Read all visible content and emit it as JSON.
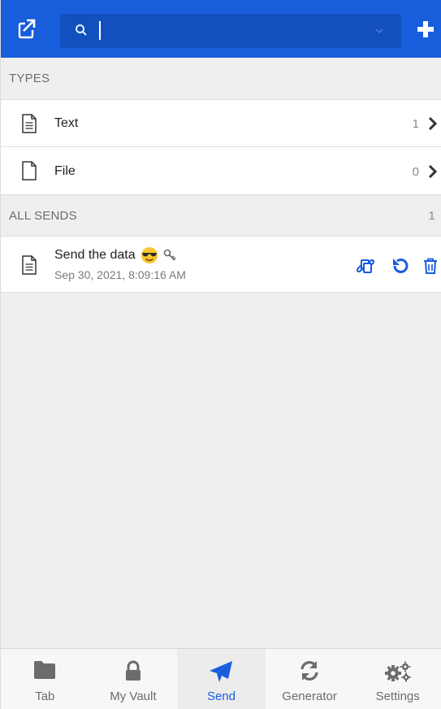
{
  "header": {
    "search_placeholder": "",
    "search_value": ""
  },
  "types_section": {
    "label": "TYPES",
    "items": [
      {
        "label": "Text",
        "count": "1"
      },
      {
        "label": "File",
        "count": "0"
      }
    ]
  },
  "all_sends_section": {
    "label": "ALL SENDS",
    "count": "1",
    "items": [
      {
        "title": "Send the data",
        "date": "Sep 30, 2021, 8:09:16 AM"
      }
    ]
  },
  "nav": {
    "items": [
      {
        "label": "Tab",
        "icon": "folder-icon"
      },
      {
        "label": "My Vault",
        "icon": "lock-icon"
      },
      {
        "label": "Send",
        "icon": "paper-plane-icon"
      },
      {
        "label": "Generator",
        "icon": "refresh-icon"
      },
      {
        "label": "Settings",
        "icon": "cogs-icon"
      }
    ],
    "active": "Send"
  },
  "colors": {
    "brand": "#175ddc",
    "background": "#efefef",
    "text": "#1f1f1f",
    "muted": "#7a7a7a"
  }
}
